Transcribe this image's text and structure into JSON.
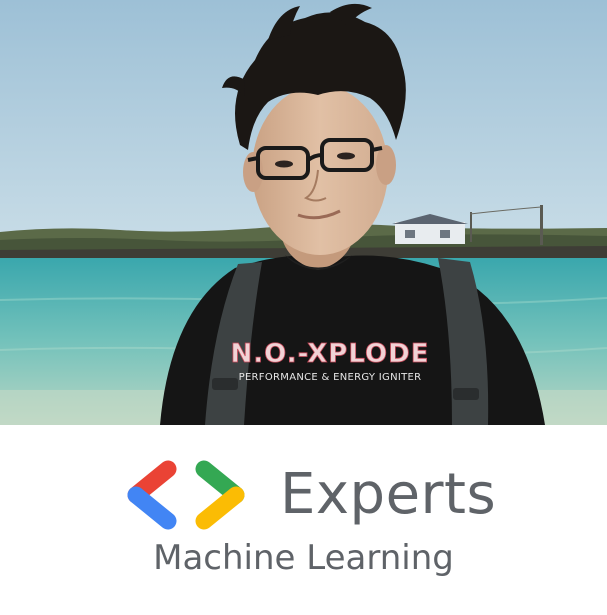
{
  "photo": {
    "shirt_brand": "N.O.-XPLODE",
    "shirt_tagline": "PERFORMANCE & ENERGY IGNITER",
    "colors": {
      "sky": "#a9c8dc",
      "sea": "#5fb9b4",
      "shirt": "#141414",
      "hair": "#1b1714",
      "skin": "#d9b79b"
    }
  },
  "badge": {
    "title": "Experts",
    "subtitle": "Machine Learning",
    "logo_colors": {
      "red": "#ea4335",
      "blue": "#4285f4",
      "green": "#34a853",
      "yellow": "#fbbc04"
    },
    "text_color": "#5f6368"
  }
}
